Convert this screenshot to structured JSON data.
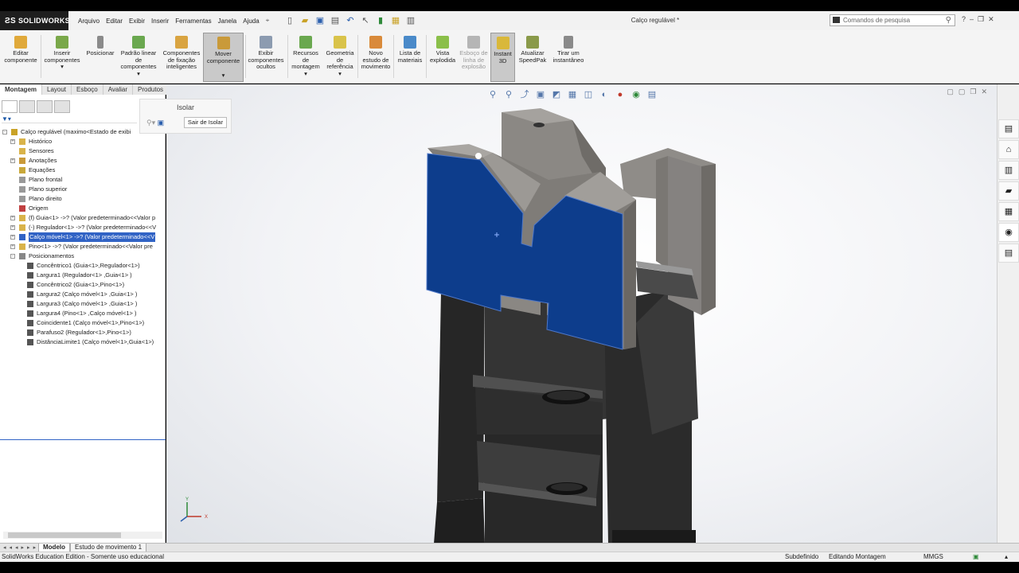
{
  "app": {
    "brand": "SOLIDWORKS",
    "title": "Calço regulável *",
    "menu": [
      "Arquivo",
      "Editar",
      "Exibir",
      "Inserir",
      "Ferramentas",
      "Janela",
      "Ajuda"
    ],
    "search_placeholder": "Comandos de pesquisa"
  },
  "ribbon": {
    "buttons": [
      {
        "label": "Editar componente",
        "icon": "edit-component-icon",
        "color": "#e0a93a"
      },
      {
        "label": "Inserir componentes",
        "icon": "insert-components-icon",
        "color": "#7aa84a"
      },
      {
        "label": "Posicionar",
        "icon": "mate-paperclip-icon",
        "color": "#8a8a8a"
      },
      {
        "label": "Padrão linear de componentes",
        "icon": "linear-pattern-icon",
        "color": "#6aa84f"
      },
      {
        "label": "Componentes de fixação inteligentes",
        "icon": "smart-fasteners-icon",
        "color": "#d9a441"
      },
      {
        "label": "Mover componente",
        "icon": "move-component-icon",
        "color": "#c99a3a"
      },
      {
        "label": "Exibir componentes ocultos",
        "icon": "show-hidden-icon",
        "color": "#8c9bb0"
      },
      {
        "label": "Recursos de montagem",
        "icon": "assembly-features-icon",
        "color": "#6aa84f"
      },
      {
        "label": "Geometria de referência",
        "icon": "reference-geometry-icon",
        "color": "#d9c34a"
      },
      {
        "label": "Novo estudo de movimento",
        "icon": "motion-study-icon",
        "color": "#d98a3a"
      },
      {
        "label": "Lista de materiais",
        "icon": "bill-of-materials-icon",
        "color": "#4a8ac9"
      },
      {
        "label": "Vista explodida",
        "icon": "exploded-view-icon",
        "color": "#8bbf4a"
      },
      {
        "label": "Esboço de linha de explosão",
        "icon": "explode-line-sketch-icon",
        "color": "#b5b5b5"
      },
      {
        "label": "Instant 3D",
        "icon": "instant3d-icon",
        "color": "#d9b83a"
      },
      {
        "label": "Atualizar SpeedPak",
        "icon": "speedpak-icon",
        "color": "#8a9a4a"
      },
      {
        "label": "Tirar um instantâneo",
        "icon": "snapshot-icon",
        "color": "#8a8a8a"
      }
    ]
  },
  "tabs": [
    "Montagem",
    "Layout",
    "Esboço",
    "Avaliar",
    "Produtos Office"
  ],
  "isolate": {
    "title": "Isolar",
    "exit_label": "Sair de Isolar"
  },
  "tree": [
    {
      "label": "Calço regulável  (maximo<Estado de exibi",
      "icon": "assembly-icon",
      "color": "#c9a227",
      "indent": 0,
      "expand": "-"
    },
    {
      "label": "Histórico",
      "icon": "history-icon",
      "color": "#d9b34a",
      "indent": 1,
      "expand": "+"
    },
    {
      "label": "Sensores",
      "icon": "sensor-icon",
      "color": "#d9b34a",
      "indent": 1,
      "expand": ""
    },
    {
      "label": "Anotações",
      "icon": "annotations-icon",
      "color": "#c99a3a",
      "indent": 1,
      "expand": "+"
    },
    {
      "label": "Equações",
      "icon": "equations-icon",
      "color": "#c9a83a",
      "indent": 1,
      "expand": ""
    },
    {
      "label": "Plano frontal",
      "icon": "plane-icon",
      "color": "#999999",
      "indent": 1,
      "expand": ""
    },
    {
      "label": "Plano superior",
      "icon": "plane-icon",
      "color": "#999999",
      "indent": 1,
      "expand": ""
    },
    {
      "label": "Plano direito",
      "icon": "plane-icon",
      "color": "#999999",
      "indent": 1,
      "expand": ""
    },
    {
      "label": "Origem",
      "icon": "origin-icon",
      "color": "#c04040",
      "indent": 1,
      "expand": ""
    },
    {
      "label": "(f) Guia<1> ->? (Valor predeterminado<<Valor p",
      "icon": "part-icon",
      "color": "#d9b34a",
      "indent": 1,
      "expand": "+"
    },
    {
      "label": "(-) Regulador<1> ->? (Valor predeterminado<<V",
      "icon": "part-icon",
      "color": "#d9b34a",
      "indent": 1,
      "expand": "+"
    },
    {
      "label": "Calço móvel<1> ->? (Valor predeterminado<<V",
      "icon": "part-icon",
      "color": "#3163c5",
      "indent": 1,
      "expand": "+",
      "selected": true
    },
    {
      "label": "Pino<1> ->? (Valor predeterminado<<Valor pre",
      "icon": "part-icon",
      "color": "#d9b34a",
      "indent": 1,
      "expand": "+"
    },
    {
      "label": "Posicionamentos",
      "icon": "mates-icon",
      "color": "#888888",
      "indent": 1,
      "expand": "-"
    },
    {
      "label": "Concêntrico1 (Guia<1>,Regulador<1>)",
      "icon": "concentric-icon",
      "color": "#555555",
      "indent": 2,
      "expand": ""
    },
    {
      "label": "Largura1 (Regulador<1> ,Guia<1> )",
      "icon": "width-mate-icon",
      "color": "#555555",
      "indent": 2,
      "expand": ""
    },
    {
      "label": "Concêntrico2 (Guia<1>,Pino<1>)",
      "icon": "concentric-icon",
      "color": "#555555",
      "indent": 2,
      "expand": ""
    },
    {
      "label": "Largura2 (Calço móvel<1> ,Guia<1> )",
      "icon": "width-mate-icon",
      "color": "#555555",
      "indent": 2,
      "expand": ""
    },
    {
      "label": "Largura3 (Calço móvel<1> ,Guia<1> )",
      "icon": "width-mate-icon",
      "color": "#555555",
      "indent": 2,
      "expand": ""
    },
    {
      "label": "Largura4 (Pino<1> ,Calço móvel<1> )",
      "icon": "width-mate-icon",
      "color": "#555555",
      "indent": 2,
      "expand": ""
    },
    {
      "label": "Coincidente1 (Calço móvel<1>,Pino<1>)",
      "icon": "coincident-icon",
      "color": "#555555",
      "indent": 2,
      "expand": ""
    },
    {
      "label": "Parafuso2 (Regulador<1>,Pino<1>)",
      "icon": "screw-mate-icon",
      "color": "#555555",
      "indent": 2,
      "expand": ""
    },
    {
      "label": "DistânciaLimite1 (Calço móvel<1>,Guia<1>)",
      "icon": "limit-distance-icon",
      "color": "#555555",
      "indent": 2,
      "expand": ""
    }
  ],
  "bottom_tabs": [
    "Modelo",
    "Estudo de movimento 1"
  ],
  "status": {
    "edition": "SolidWorks Education Edition - Somente uso educacional",
    "definition": "Subdefinido",
    "mode": "Editando Montagem",
    "units": "MMGS"
  },
  "colors": {
    "selected_face": "#0d3d8c",
    "part_gray": "#8b8884",
    "base_dark": "#2a2a2a"
  }
}
